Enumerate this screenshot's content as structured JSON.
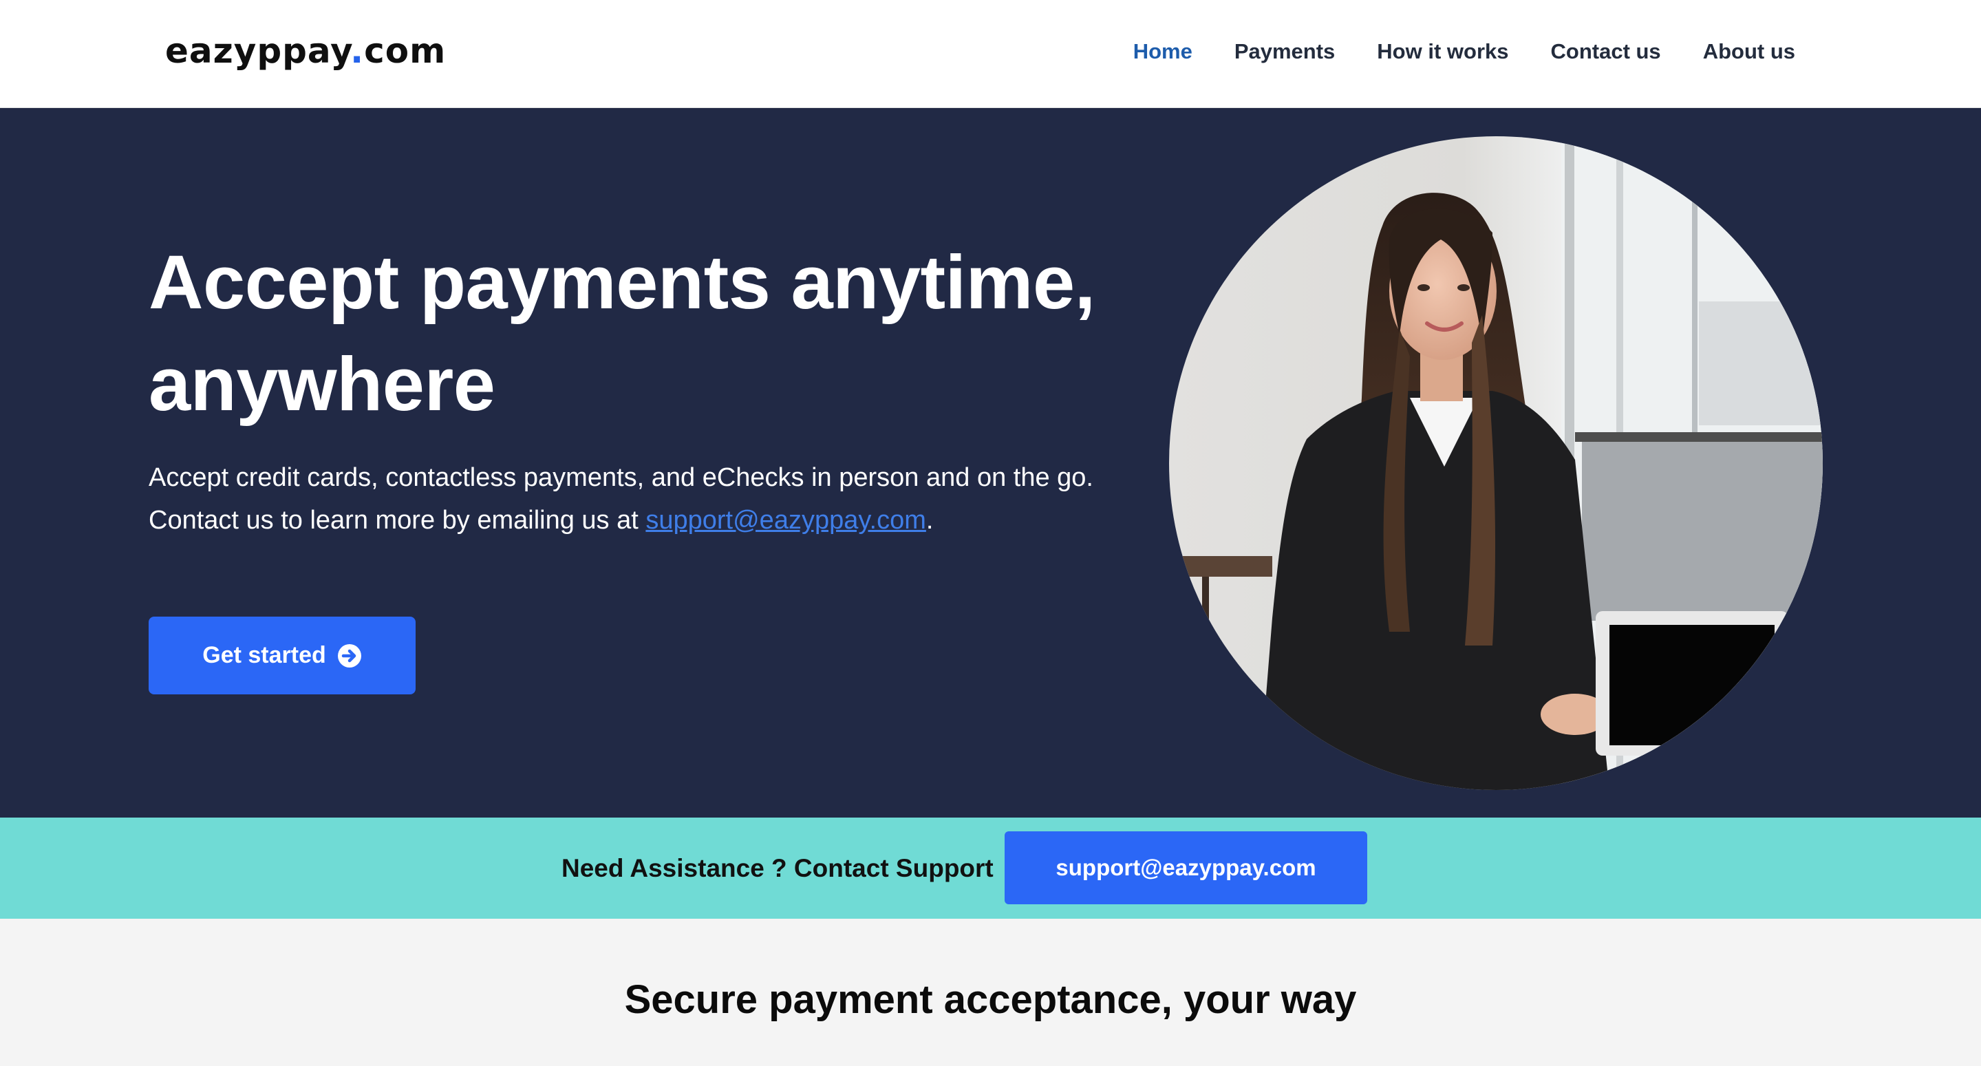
{
  "header": {
    "logo": {
      "prefix": "eazyppay",
      "dot": ".",
      "suffix": "com"
    },
    "nav": [
      {
        "label": "Home",
        "active": true
      },
      {
        "label": "Payments",
        "active": false
      },
      {
        "label": "How it works",
        "active": false
      },
      {
        "label": "Contact us",
        "active": false
      },
      {
        "label": "About us",
        "active": false
      }
    ]
  },
  "hero": {
    "title": "Accept payments anytime, anywhere",
    "text_before_link": "Accept credit cards, contactless payments, and eChecks in person and on the go. Contact us to learn more by emailing us at ",
    "email_link": "support@eazyppay.com",
    "text_after_link": ".",
    "cta_label": "Get started",
    "cta_icon": "arrow-circle-right-icon",
    "image": "woman-at-laptop-photo"
  },
  "support": {
    "label": "Need Assistance ? Contact Support",
    "button_label": "support@eazyppay.com"
  },
  "section": {
    "title": "Secure payment acceptance, your way"
  },
  "colors": {
    "header_bg": "#ffffff",
    "hero_bg": "#212945",
    "accent_blue": "#2b67f6",
    "active_nav": "#1d5cab",
    "support_strip": "#70dbd5",
    "page_bg": "#f4f4f4"
  }
}
